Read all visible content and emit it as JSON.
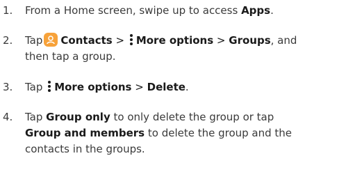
{
  "steps": [
    {
      "number": "1.",
      "lines": [
        {
          "text_a": "From a Home screen, swipe up to access ",
          "bold_a": "Apps",
          "text_b": "."
        }
      ]
    },
    {
      "number": "2.",
      "line1": {
        "pre": "Tap",
        "contacts": "Contacts",
        "sep1": ">",
        "more_options": "More options",
        "sep2": ">",
        "groups": "Groups",
        "post": ", and"
      },
      "line2": "then tap a group."
    },
    {
      "number": "3.",
      "pre": "Tap",
      "more_options": "More options",
      "sep": ">",
      "delete": "Delete",
      "post": "."
    },
    {
      "number": "4.",
      "line1": {
        "pre": "Tap ",
        "bold": "Group only",
        "post": " to only delete the group or tap"
      },
      "line2": {
        "bold": "Group and members",
        "post": " to delete the group and the"
      },
      "line3": "contacts in the groups."
    }
  ],
  "icons": {
    "contacts_icon": "contacts-app-icon",
    "more_options_icon": "vertical-ellipsis-icon",
    "contacts_color": "#f7a23a"
  }
}
